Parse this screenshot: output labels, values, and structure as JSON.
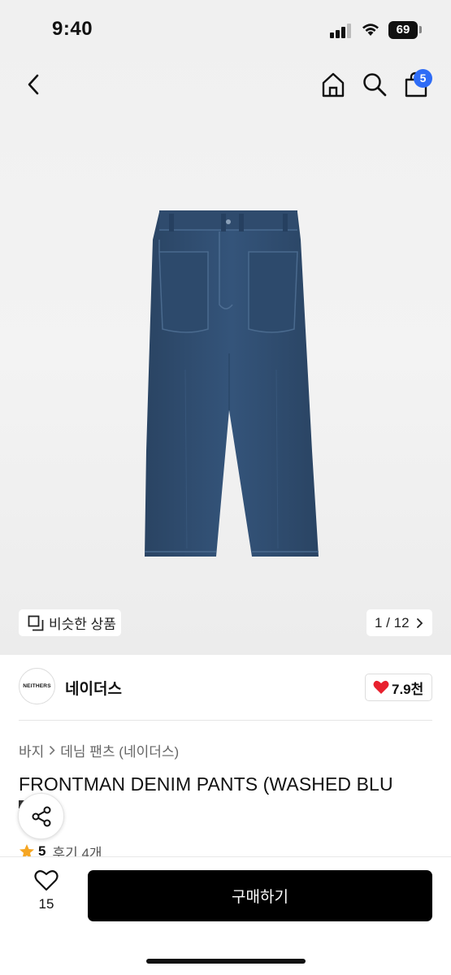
{
  "status_bar": {
    "time": "9:40",
    "battery": "69"
  },
  "nav": {
    "cart_count": "5"
  },
  "brand": {
    "logo_text": "NEITHERS",
    "name": "네이더스",
    "likes": "7.9천"
  },
  "gallery": {
    "similar_label": "비슷한 상품",
    "pager": "1 / 12"
  },
  "breadcrumb": {
    "category": "바지",
    "subcategory": "데님 팬츠 (네이더스)"
  },
  "product": {
    "title": "FRONTMAN DENIM PANTS (WASHED BLU",
    "rating": "5",
    "reviews": "후기 4개"
  },
  "bottom": {
    "wish_count": "15",
    "buy_label": "구매하기"
  },
  "colors": {
    "accent": "#2e6cf6",
    "heart": "#e8212e",
    "star": "#f5a623",
    "denim": "#2c4a6b"
  }
}
